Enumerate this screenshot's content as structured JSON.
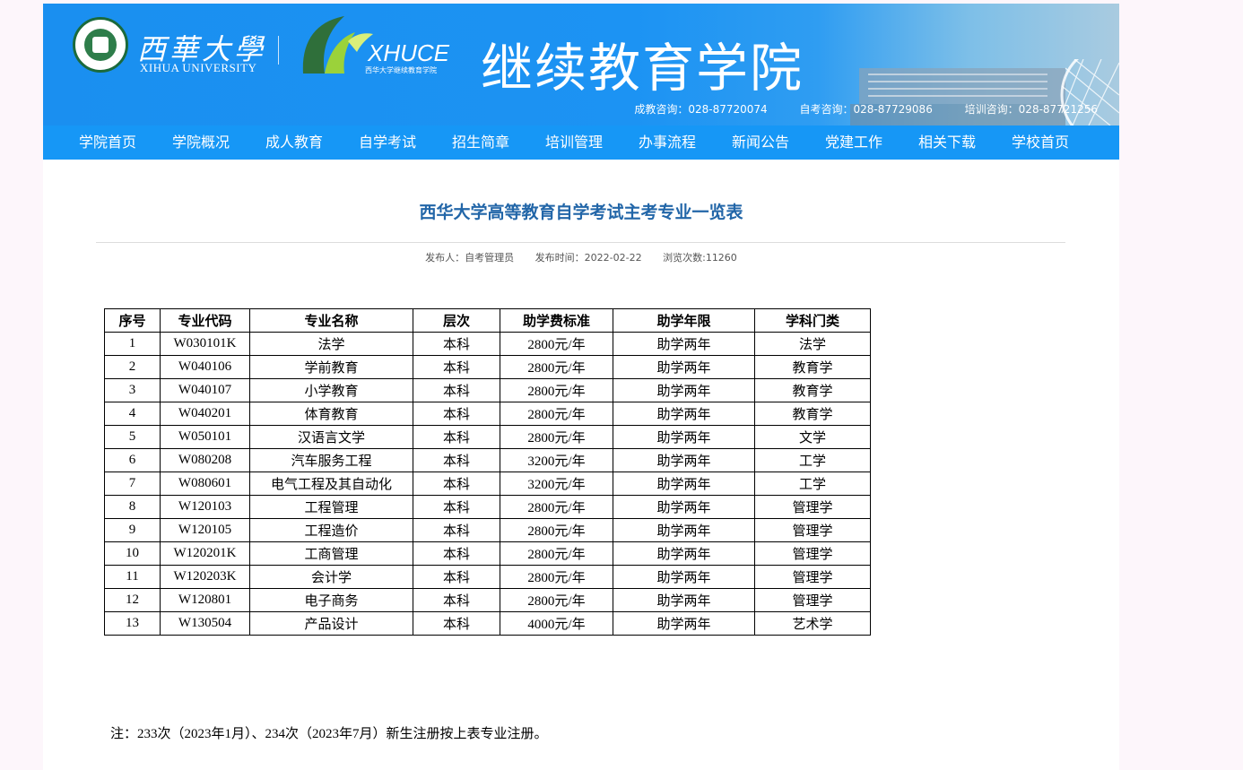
{
  "header": {
    "university_name": "西華大學",
    "university_name_en": "XIHUA UNIVERSITY",
    "brand": "XHUCE",
    "brand_sub": "西华大学继续教育学院",
    "college_name": "继续教育学院",
    "contacts": [
      "成教咨询：028-87720074",
      "自考咨询：028-87729086",
      "培训咨询：028-87721256"
    ]
  },
  "nav": {
    "items": [
      "学院首页",
      "学院概况",
      "成人教育",
      "自学考试",
      "招生简章",
      "培训管理",
      "办事流程",
      "新闻公告",
      "党建工作",
      "相关下载",
      "学校首页"
    ]
  },
  "article": {
    "title": "西华大学高等教育自学考试主考专业一览表",
    "publisher": "发布人：自考管理员",
    "publish_time": "发布时间：2022-02-22",
    "views": "浏览次数:11260",
    "table": {
      "headers": [
        "序号",
        "专业代码",
        "专业名称",
        "层次",
        "助学费标准",
        "助学年限",
        "学科门类"
      ],
      "rows": [
        [
          "1",
          "W030101K",
          "法学",
          "本科",
          "2800元/年",
          "助学两年",
          "法学"
        ],
        [
          "2",
          "W040106",
          "学前教育",
          "本科",
          "2800元/年",
          "助学两年",
          "教育学"
        ],
        [
          "3",
          "W040107",
          "小学教育",
          "本科",
          "2800元/年",
          "助学两年",
          "教育学"
        ],
        [
          "4",
          "W040201",
          "体育教育",
          "本科",
          "2800元/年",
          "助学两年",
          "教育学"
        ],
        [
          "5",
          "W050101",
          "汉语言文学",
          "本科",
          "2800元/年",
          "助学两年",
          "文学"
        ],
        [
          "6",
          "W080208",
          "汽车服务工程",
          "本科",
          "3200元/年",
          "助学两年",
          "工学"
        ],
        [
          "7",
          "W080601",
          "电气工程及其自动化",
          "本科",
          "3200元/年",
          "助学两年",
          "工学"
        ],
        [
          "8",
          "W120103",
          "工程管理",
          "本科",
          "2800元/年",
          "助学两年",
          "管理学"
        ],
        [
          "9",
          "W120105",
          "工程造价",
          "本科",
          "2800元/年",
          "助学两年",
          "管理学"
        ],
        [
          "10",
          "W120201K",
          "工商管理",
          "本科",
          "2800元/年",
          "助学两年",
          "管理学"
        ],
        [
          "11",
          "W120203K",
          "会计学",
          "本科",
          "2800元/年",
          "助学两年",
          "管理学"
        ],
        [
          "12",
          "W120801",
          "电子商务",
          "本科",
          "2800元/年",
          "助学两年",
          "管理学"
        ],
        [
          "13",
          "W130504",
          "产品设计",
          "本科",
          "4000元/年",
          "助学两年",
          "艺术学"
        ]
      ]
    },
    "note": "注：233次（2023年1月）、234次（2023年7月）新生注册按上表专业注册。"
  },
  "colors": {
    "banner": "#1a8ff0",
    "nav": "#1697f6",
    "title": "#2266a8"
  }
}
